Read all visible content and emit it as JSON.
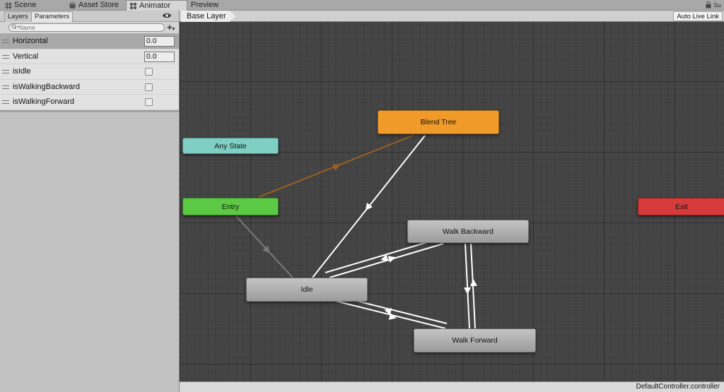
{
  "tabs": [
    {
      "label": "Scene",
      "icon": "grid-icon"
    },
    {
      "label": "Asset Store",
      "icon": "store-icon"
    },
    {
      "label": "Animator",
      "icon": "animator-icon",
      "active": true
    },
    {
      "label": "Preview",
      "icon": ""
    }
  ],
  "left_panel": {
    "tabs": [
      "Layers",
      "Parameters"
    ],
    "search_placeholder": "Name",
    "add_label": "+",
    "parameters": [
      {
        "name": "Horizontal",
        "type": "float",
        "value": "0.0",
        "selected": true
      },
      {
        "name": "Vertical",
        "type": "float",
        "value": "0.0"
      },
      {
        "name": "isIdle",
        "type": "bool",
        "checked": false
      },
      {
        "name": "isWalkingBackward",
        "type": "bool",
        "checked": false
      },
      {
        "name": "isWalkingForward",
        "type": "bool",
        "checked": false
      }
    ]
  },
  "graph": {
    "breadcrumb": "Base Layer",
    "auto_live_link": "Auto Live Link",
    "status_file": "DefaultController.controller",
    "states": {
      "blend_tree": {
        "label": "Blend Tree",
        "color": "#f09a2a"
      },
      "any_state": {
        "label": "Any State",
        "color": "#7fcfc4"
      },
      "entry": {
        "label": "Entry",
        "color": "#5bc943"
      },
      "exit": {
        "label": "Exit",
        "color": "#d63a3a"
      },
      "walk_backward": {
        "label": "Walk Backward"
      },
      "idle": {
        "label": "Idle"
      },
      "walk_forward": {
        "label": "Walk Forward"
      }
    }
  }
}
